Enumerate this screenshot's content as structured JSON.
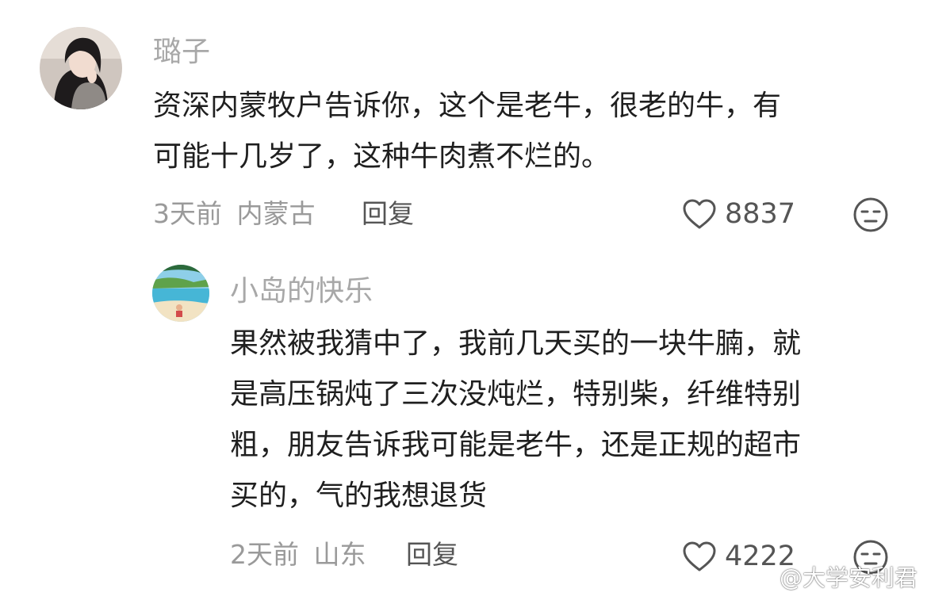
{
  "comments": [
    {
      "username": "璐子",
      "text_lines": [
        "资深内蒙牧户告诉你，这个是老牛，很老的牛，有",
        "可能十几岁了，这种牛肉煮不烂的。"
      ],
      "time": "3天前",
      "location": "内蒙古",
      "reply_label": "回复",
      "likes": "8837"
    },
    {
      "username": "小岛的快乐",
      "text_lines": [
        "果然被我猜中了，我前几天买的一块牛腩，就",
        "是高压锅炖了三次没炖烂，特别柴，纤维特别",
        "粗，朋友告诉我可能是老牛，还是正规的超市",
        "买的，气的我想退货"
      ],
      "time": "2天前",
      "location": "山东",
      "reply_label": "回复",
      "likes": "4222"
    }
  ],
  "icons": {
    "like": "heart-outline-icon",
    "dislike": "unamused-face-icon",
    "watermark": "weibo-logo-icon"
  },
  "watermark": {
    "text": "@大学安利君"
  },
  "colors": {
    "username": "#a8a8a8",
    "body_text": "#1f1f1f",
    "meta": "#9a9a9a",
    "icon": "#555555"
  }
}
